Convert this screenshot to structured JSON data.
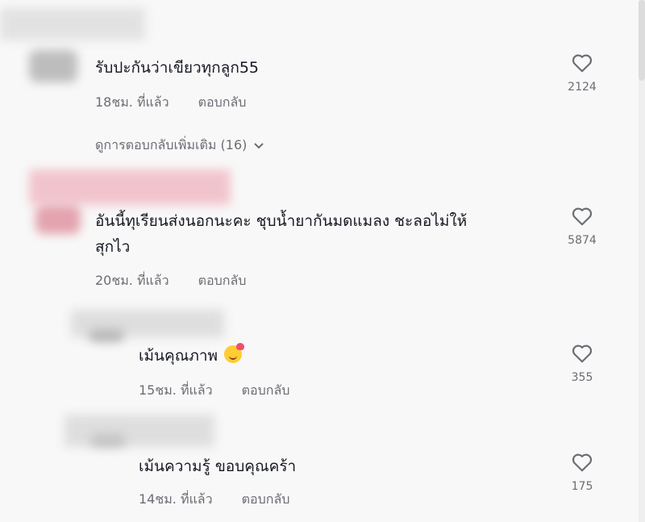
{
  "comments": [
    {
      "text": "รับปะกันว่าเขียวทุกลูก55",
      "time": "18ชม. ที่แล้ว",
      "reply": "ตอบกลับ",
      "likes": "2124"
    },
    {
      "text_line1": "อันนี้ทุเรียนส่งนอกนะคะ ชุบน้ำยากันมดแมลง ชะลอไม่ให้",
      "text_line2": "สุกไว",
      "time": "20ชม. ที่แล้ว",
      "reply": "ตอบกลับ",
      "likes": "5874"
    }
  ],
  "more_replies": "ดูการตอบกลับเพิ่มเติม (16)",
  "replies": [
    {
      "text": "เม้นคุณภาพ",
      "emoji": "smiling-face-with-hearts",
      "time": "15ชม. ที่แล้ว",
      "reply": "ตอบกลับ",
      "likes": "355"
    },
    {
      "text": "เม้นความรู้ ขอบคุณคร้า",
      "time": "14ชม. ที่แล้ว",
      "reply": "ตอบกลับ",
      "likes": "175"
    }
  ],
  "colors": {
    "background": "#f8f8f8",
    "text": "#161823",
    "secondary_text": "#6b6d74",
    "icon": "#6b6d74"
  }
}
